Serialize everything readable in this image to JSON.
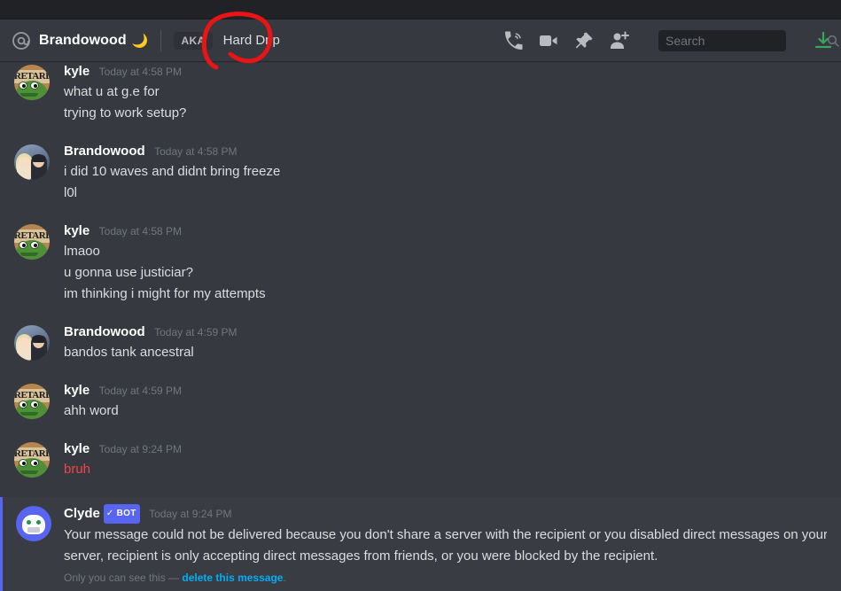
{
  "window": {
    "titlebar_color": "#202225",
    "app_background": "#36393f"
  },
  "header": {
    "at_icon": "at-icon",
    "dm_name": "Brandowood",
    "status_emoji": "🌙",
    "aka_label": "AKA",
    "aka_nickname": "Hard Drip",
    "icons": [
      {
        "name": "voice-call-icon",
        "label": "Start Voice Call"
      },
      {
        "name": "video-call-icon",
        "label": "Start Video Call"
      },
      {
        "name": "pin-icon",
        "label": "Pinned Messages"
      },
      {
        "name": "add-friend-icon",
        "label": "Add Friends to DM"
      }
    ],
    "search": {
      "placeholder": "Search",
      "value": "",
      "icon": "search-icon"
    },
    "inbox": {
      "icon": "inbox-download-icon",
      "color": "#3ba55c"
    }
  },
  "annotation": {
    "type": "hand-drawn-circle",
    "color": "#e81416",
    "target": "Hard Drip"
  },
  "messages": [
    {
      "author": "kyle",
      "avatar": "pepe-retard-avatar",
      "avatar_text": "RETARD",
      "timestamp": "Today at 4:58 PM",
      "author_color": "#ffffff",
      "lines": [
        {
          "text": "what u at g.e for",
          "style": "normal"
        },
        {
          "text": "trying to work setup?",
          "style": "normal"
        }
      ]
    },
    {
      "author": "Brandowood",
      "avatar": "couple-photo-avatar",
      "timestamp": "Today at 4:58 PM",
      "author_color": "#ffffff",
      "lines": [
        {
          "text": "i did 10 waves and didnt bring freeze",
          "style": "normal"
        },
        {
          "text": "l0l",
          "style": "normal"
        }
      ]
    },
    {
      "author": "kyle",
      "avatar": "pepe-retard-avatar",
      "avatar_text": "RETARD",
      "timestamp": "Today at 4:58 PM",
      "author_color": "#ffffff",
      "lines": [
        {
          "text": "lmaoo",
          "style": "normal"
        },
        {
          "text": "u gonna use justiciar?",
          "style": "normal"
        },
        {
          "text": "im thinking i might for my attempts",
          "style": "normal"
        }
      ]
    },
    {
      "author": "Brandowood",
      "avatar": "couple-photo-avatar",
      "timestamp": "Today at 4:59 PM",
      "author_color": "#ffffff",
      "lines": [
        {
          "text": "bandos tank ancestral",
          "style": "normal"
        }
      ]
    },
    {
      "author": "kyle",
      "avatar": "pepe-retard-avatar",
      "avatar_text": "RETARD",
      "timestamp": "Today at 4:59 PM",
      "author_color": "#ffffff",
      "lines": [
        {
          "text": "ahh word",
          "style": "normal"
        }
      ]
    },
    {
      "author": "kyle",
      "avatar": "pepe-retard-avatar",
      "avatar_text": "RETARD",
      "timestamp": "Today at 9:24 PM",
      "author_color": "#ffffff",
      "lines": [
        {
          "text": "bruh",
          "style": "failed"
        }
      ]
    }
  ],
  "ephemeral_message": {
    "author": "Clyde",
    "avatar": "clyde-bot-avatar",
    "bot_badge": "BOT",
    "bot_badge_check": "✓",
    "bot_badge_color": "#5865f2",
    "timestamp": "Today at 9:24 PM",
    "line1": "Your message could not be delivered because you don't share a server with the recipient or you disabled direct messages on your sha",
    "line2": "server, recipient is only accepting direct messages from friends, or you were blocked by the recipient.",
    "note_prefix": "Only you can see this — ",
    "note_link": "delete this message",
    "note_suffix": ".",
    "accent_color": "#5865f2"
  }
}
